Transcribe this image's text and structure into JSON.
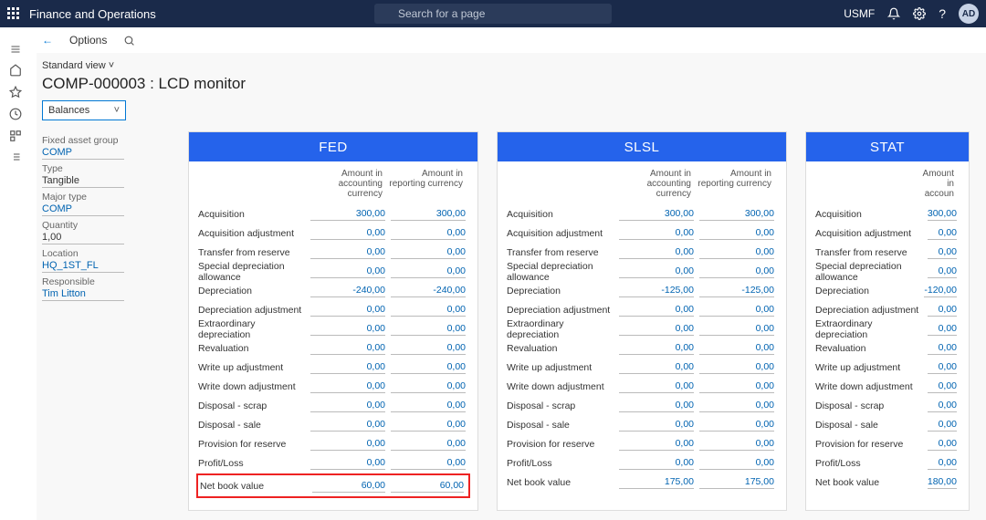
{
  "app": {
    "title": "Finance and Operations",
    "searchPlaceholder": "Search for a page",
    "entity": "USMF",
    "userInitials": "AD"
  },
  "subhead": {
    "options": "Options"
  },
  "page": {
    "stdview": "Standard view",
    "title": "COMP-000003 : LCD monitor",
    "combo": "Balances"
  },
  "side": {
    "group_l": "Fixed asset group",
    "group_v": "COMP",
    "type_l": "Type",
    "type_v": "Tangible",
    "major_l": "Major type",
    "major_v": "COMP",
    "qty_l": "Quantity",
    "qty_v": "1,00",
    "loc_l": "Location",
    "loc_v": "HQ_1ST_FL",
    "resp_l": "Responsible",
    "resp_v": "Tim Litton"
  },
  "rowLabels": [
    "Acquisition",
    "Acquisition adjustment",
    "Transfer from reserve",
    "Special depreciation allowance",
    "Depreciation",
    "Depreciation adjustment",
    "Extraordinary depreciation",
    "Revaluation",
    "Write up adjustment",
    "Write down adjustment",
    "Disposal - scrap",
    "Disposal - sale",
    "Provision for reserve",
    "Profit/Loss",
    "Net book value"
  ],
  "colHeads": {
    "acc": "Amount in accounting currency",
    "rep": "Amount in reporting currency",
    "accShort": "Amount in accoun"
  },
  "books": {
    "fed": {
      "title": "FED",
      "acc": [
        "300,00",
        "0,00",
        "0,00",
        "0,00",
        "-240,00",
        "0,00",
        "0,00",
        "0,00",
        "0,00",
        "0,00",
        "0,00",
        "0,00",
        "0,00",
        "0,00",
        "60,00"
      ],
      "rep": [
        "300,00",
        "0,00",
        "0,00",
        "0,00",
        "-240,00",
        "0,00",
        "0,00",
        "0,00",
        "0,00",
        "0,00",
        "0,00",
        "0,00",
        "0,00",
        "0,00",
        "60,00"
      ]
    },
    "slsl": {
      "title": "SLSL",
      "acc": [
        "300,00",
        "0,00",
        "0,00",
        "0,00",
        "-125,00",
        "0,00",
        "0,00",
        "0,00",
        "0,00",
        "0,00",
        "0,00",
        "0,00",
        "0,00",
        "0,00",
        "175,00"
      ],
      "rep": [
        "300,00",
        "0,00",
        "0,00",
        "0,00",
        "-125,00",
        "0,00",
        "0,00",
        "0,00",
        "0,00",
        "0,00",
        "0,00",
        "0,00",
        "0,00",
        "0,00",
        "175,00"
      ]
    },
    "stat": {
      "title": "STAT",
      "acc": [
        "300,00",
        "0,00",
        "0,00",
        "0,00",
        "-120,00",
        "0,00",
        "0,00",
        "0,00",
        "0,00",
        "0,00",
        "0,00",
        "0,00",
        "0,00",
        "0,00",
        "180,00"
      ]
    }
  },
  "highlightRowIndex": 14
}
